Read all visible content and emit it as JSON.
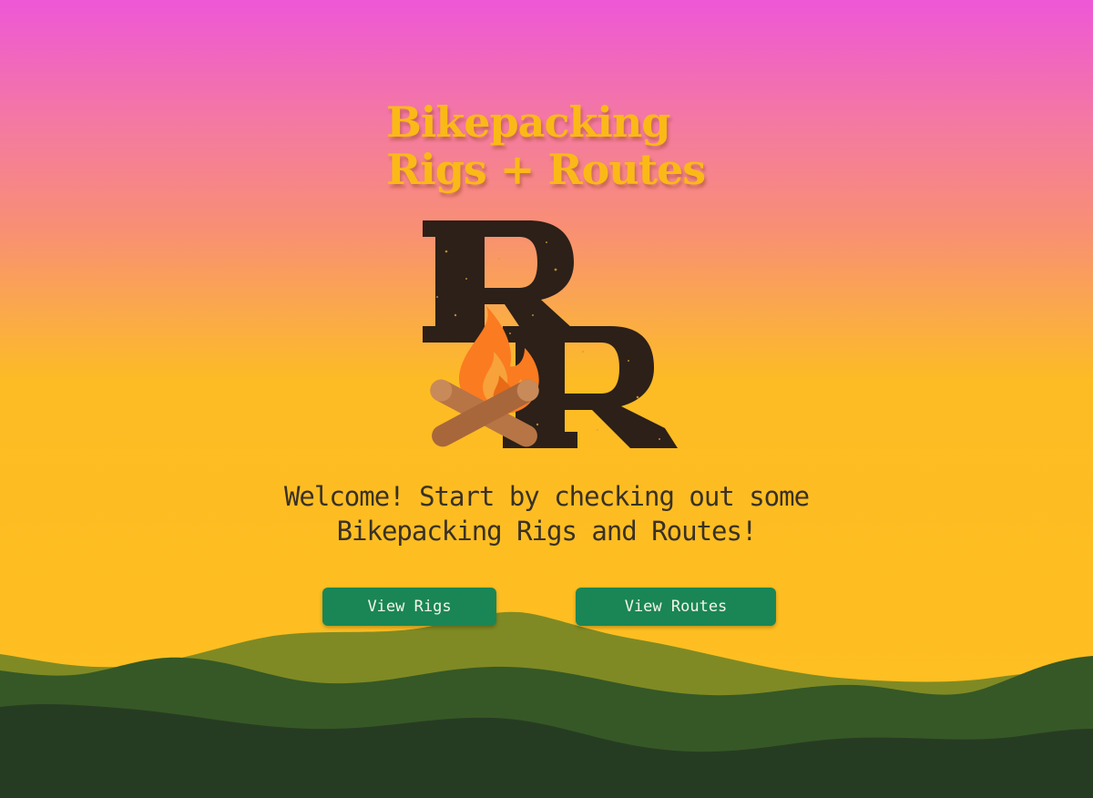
{
  "header": {
    "title_line1": "Bikepacking",
    "title_line2": "Rigs + Routes"
  },
  "logo": {
    "letters": "RR",
    "icon": "campfire-icon"
  },
  "welcome": {
    "line1": "Welcome! Start by checking out some",
    "line2": "Bikepacking Rigs and Routes!"
  },
  "actions": {
    "view_rigs_label": "View Rigs",
    "view_routes_label": "View Routes"
  },
  "colors": {
    "sky_top": "#ee57d6",
    "sky_bottom": "#fec021",
    "title": "#fbb917",
    "button": "#1a8655",
    "hill_light": "#808a24",
    "hill_mid": "#365826",
    "hill_dark": "#263c22",
    "logo_letters": "#2c2018"
  }
}
